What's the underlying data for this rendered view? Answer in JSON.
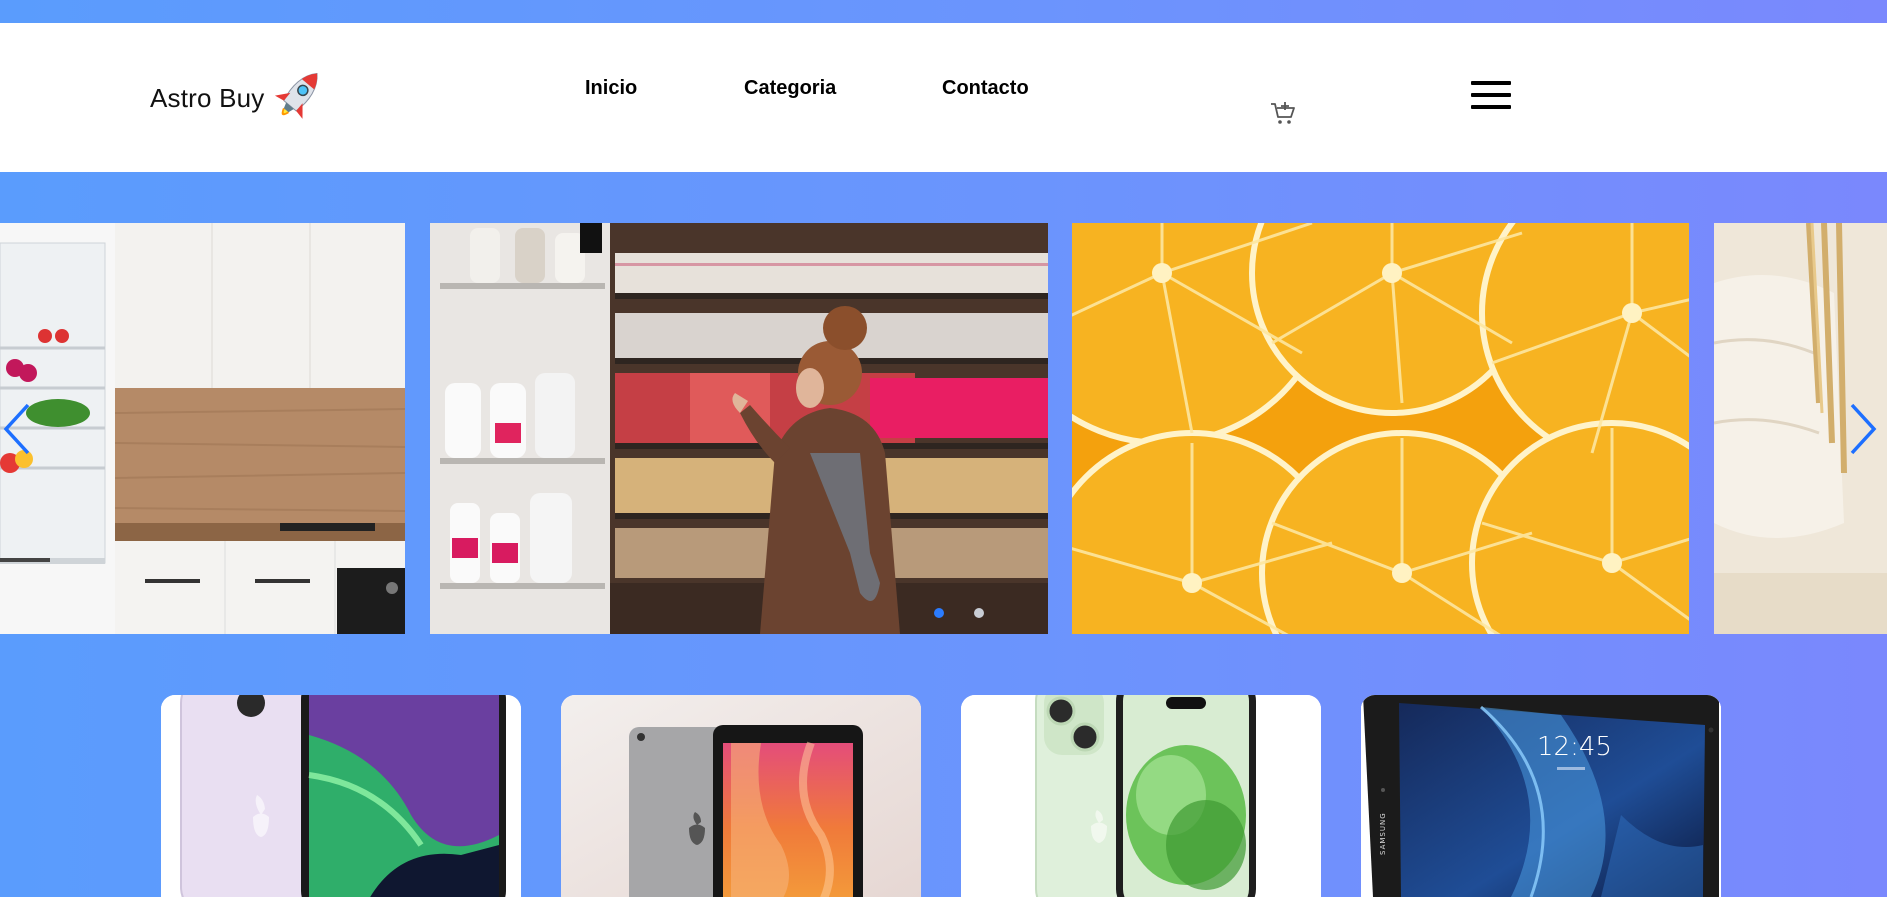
{
  "header": {
    "logo_text": "Astro Buy",
    "logo_icon": "rocket-icon",
    "nav": [
      {
        "label": "Inicio"
      },
      {
        "label": "Categoria"
      },
      {
        "label": "Contacto"
      }
    ],
    "cart_icon": "cart-add-icon",
    "menu_icon": "hamburger-menu-icon"
  },
  "carousel": {
    "slides": [
      {
        "subject": "kitchen-refrigerator"
      },
      {
        "subject": "woman-at-store-shelves"
      },
      {
        "subject": "orange-slices"
      },
      {
        "subject": "wicker-basket"
      }
    ],
    "active_dot": 0,
    "dot_count": 2,
    "prev_icon": "chevron-left-icon",
    "next_icon": "chevron-right-icon"
  },
  "products": [
    {
      "subject": "purple-smartphone"
    },
    {
      "subject": "tablet-orange-wallpaper"
    },
    {
      "subject": "green-smartphone"
    },
    {
      "subject": "samsung-tablet",
      "screen_time": "12:45",
      "brand": "SAMSUNG"
    }
  ],
  "colors": {
    "background_start": "#5a9cfd",
    "background_end": "#7a88fd",
    "header_bg": "#ffffff",
    "accent": "#2b7cff"
  }
}
